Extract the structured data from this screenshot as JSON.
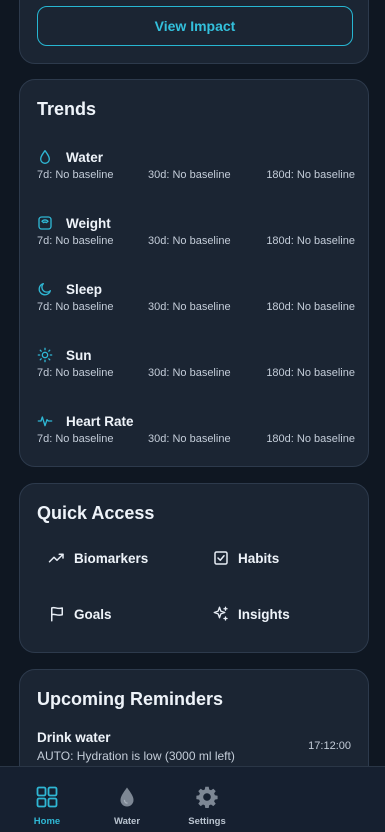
{
  "impact": {
    "button_label": "View Impact"
  },
  "trends": {
    "title": "Trends",
    "items": [
      {
        "name": "Water",
        "icon": "droplet-icon",
        "d7": "7d: No baseline",
        "d30": "30d: No baseline",
        "d180": "180d: No baseline"
      },
      {
        "name": "Weight",
        "icon": "scale-icon",
        "d7": "7d: No baseline",
        "d30": "30d: No baseline",
        "d180": "180d: No baseline"
      },
      {
        "name": "Sleep",
        "icon": "moon-icon",
        "d7": "7d: No baseline",
        "d30": "30d: No baseline",
        "d180": "180d: No baseline"
      },
      {
        "name": "Sun",
        "icon": "sun-icon",
        "d7": "7d: No baseline",
        "d30": "30d: No baseline",
        "d180": "180d: No baseline"
      },
      {
        "name": "Heart Rate",
        "icon": "pulse-icon",
        "d7": "7d: No baseline",
        "d30": "30d: No baseline",
        "d180": "180d: No baseline"
      }
    ]
  },
  "quick_access": {
    "title": "Quick Access",
    "items": [
      {
        "label": "Biomarkers",
        "icon": "trend-line-icon"
      },
      {
        "label": "Habits",
        "icon": "checkbox-icon"
      },
      {
        "label": "Goals",
        "icon": "flag-icon"
      },
      {
        "label": "Insights",
        "icon": "sparkles-icon"
      }
    ]
  },
  "reminders": {
    "title": "Upcoming Reminders",
    "items": [
      {
        "title": "Drink water",
        "subtitle": "AUTO: Hydration is low (3000 ml left)",
        "time": "17:12:00"
      }
    ]
  },
  "nav": {
    "items": [
      {
        "label": "Home",
        "icon": "grid-icon",
        "active": true
      },
      {
        "label": "Water",
        "icon": "droplet-icon",
        "active": false
      },
      {
        "label": "Settings",
        "icon": "gear-icon",
        "active": false
      }
    ]
  },
  "colors": {
    "accent": "#2fb7d4",
    "card": "#1b2533",
    "background": "#0f1722"
  }
}
